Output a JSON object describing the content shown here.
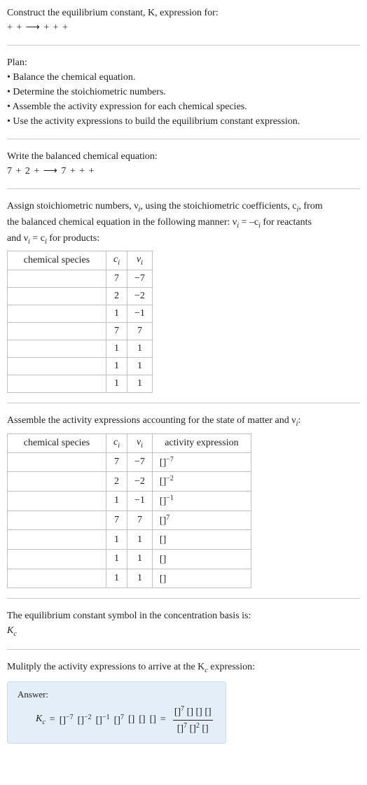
{
  "intro": {
    "l1": "Construct the equilibrium constant, K, expression for:",
    "l2": " +  +  ⟶  +  +  + ",
    "plan_h": "Plan:",
    "plan1": "• Balance the chemical equation.",
    "plan2": "• Determine the stoichiometric numbers.",
    "plan3": "• Assemble the activity expression for each chemical species.",
    "plan4": "• Use the activity expressions to build the equilibrium constant expression.",
    "bal_h": "Write the balanced chemical equation:",
    "bal_eq": "7  + 2  +  ⟶ 7  +  +  + "
  },
  "stoich": {
    "desc1": "Assign stoichiometric numbers, ν",
    "desc1b": ", using the stoichiometric coefficients, c",
    "desc1c": ", from",
    "desc2a": "the balanced chemical equation in the following manner: ν",
    "desc2b": " = –c",
    "desc2c": " for reactants",
    "desc3a": "and ν",
    "desc3b": " = c",
    "desc3c": " for products:",
    "th_species": "chemical species",
    "th_c": "c",
    "th_v": "ν",
    "rows": [
      {
        "c": "7",
        "v": "−7"
      },
      {
        "c": "2",
        "v": "−2"
      },
      {
        "c": "1",
        "v": "−1"
      },
      {
        "c": "7",
        "v": "7"
      },
      {
        "c": "1",
        "v": "1"
      },
      {
        "c": "1",
        "v": "1"
      },
      {
        "c": "1",
        "v": "1"
      }
    ]
  },
  "activity": {
    "desc1a": "Assemble the activity expressions accounting for the state of matter and ν",
    "desc1b": ":",
    "th_species": "chemical species",
    "th_c": "c",
    "th_v": "ν",
    "th_act": "activity expression",
    "rows": [
      {
        "c": "7",
        "v": "−7",
        "a": "[]",
        "ae": "−7"
      },
      {
        "c": "2",
        "v": "−2",
        "a": "[]",
        "ae": "−2"
      },
      {
        "c": "1",
        "v": "−1",
        "a": "[]",
        "ae": "−1"
      },
      {
        "c": "7",
        "v": "7",
        "a": "[]",
        "ae": "7"
      },
      {
        "c": "1",
        "v": "1",
        "a": "[]",
        "ae": ""
      },
      {
        "c": "1",
        "v": "1",
        "a": "[]",
        "ae": ""
      },
      {
        "c": "1",
        "v": "1",
        "a": "[]",
        "ae": ""
      }
    ]
  },
  "kc_label": {
    "l1": "The equilibrium constant symbol in the concentration basis is:",
    "l2": "K",
    "l2s": "c"
  },
  "final": {
    "l1a": "Mulitply the activity expressions to arrive at the K",
    "l1b": " expression:",
    "answer": "Answer:",
    "lhs": "K",
    "lhs_s": "c",
    "eq": " = ",
    "t1": "[]",
    "e1": "−7",
    "t2": "[]",
    "e2": "−2",
    "t3": "[]",
    "e3": "−1",
    "t4": "[]",
    "e4": "7",
    "t5": "[]",
    "t6": "[]",
    "t7": "[]",
    "eq2": " = ",
    "num": {
      "a": "[]",
      "ae": "7",
      "b": "[]",
      "c": "[]",
      "d": "[]"
    },
    "den": {
      "a": "[]",
      "ae": "7",
      "b": "[]",
      "be": "2",
      "c": "[]"
    }
  }
}
